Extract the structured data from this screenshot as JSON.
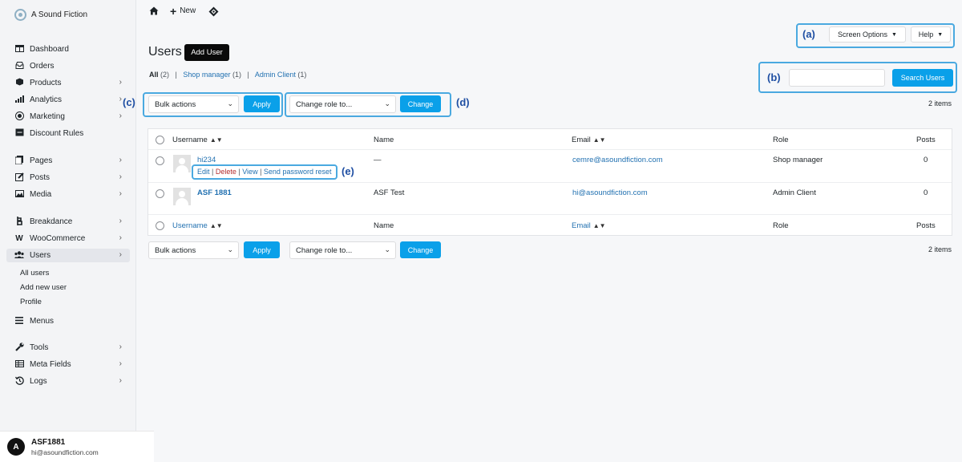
{
  "brand": {
    "name": "A Sound Fiction"
  },
  "topbar": {
    "new_label": "New"
  },
  "sidebar": {
    "items": [
      {
        "label": "Dashboard",
        "icon": "dashboard-icon"
      },
      {
        "label": "Orders",
        "icon": "orders-icon"
      },
      {
        "label": "Products",
        "icon": "products-icon"
      },
      {
        "label": "Analytics",
        "icon": "analytics-icon"
      },
      {
        "label": "Marketing",
        "icon": "marketing-icon"
      },
      {
        "label": "Discount Rules",
        "icon": "discount-icon"
      },
      {
        "label": "Pages",
        "icon": "pages-icon"
      },
      {
        "label": "Posts",
        "icon": "posts-icon"
      },
      {
        "label": "Media",
        "icon": "media-icon"
      },
      {
        "label": "Breakdance",
        "icon": "breakdance-icon"
      },
      {
        "label": "WooCommerce",
        "icon": "woocommerce-icon"
      },
      {
        "label": "Users",
        "icon": "users-icon"
      },
      {
        "label": "Menus",
        "icon": "menus-icon"
      },
      {
        "label": "Tools",
        "icon": "tools-icon"
      },
      {
        "label": "Meta Fields",
        "icon": "meta-fields-icon"
      },
      {
        "label": "Logs",
        "icon": "logs-icon"
      }
    ],
    "users_sub": [
      "All users",
      "Add new user",
      "Profile"
    ]
  },
  "account": {
    "initial": "A",
    "name": "ASF1881",
    "email": "hi@asoundfiction.com"
  },
  "header": {
    "title": "Users",
    "add_user": "Add User",
    "screen_options": "Screen Options",
    "help": "Help"
  },
  "filters": {
    "all": "All",
    "all_count": "(2)",
    "shop_manager": "Shop manager",
    "shop_manager_count": "(1)",
    "admin_client": "Admin Client",
    "admin_client_count": "(1)"
  },
  "search": {
    "value": "",
    "button": "Search Users"
  },
  "tablenav": {
    "bulk_actions": "Bulk actions",
    "apply": "Apply",
    "change_role": "Change role to...",
    "change": "Change",
    "count": "2 items"
  },
  "table": {
    "columns": {
      "username": "Username",
      "name": "Name",
      "email": "Email",
      "role": "Role",
      "posts": "Posts"
    },
    "rows": [
      {
        "username": "hi234",
        "name": "—",
        "email": "cemre@asoundfiction.com",
        "role": "Shop manager",
        "posts": "0"
      },
      {
        "username": "ASF 1881",
        "name": "ASF Test",
        "email": "hi@asoundfiction.com",
        "role": "Admin Client",
        "posts": "0"
      }
    ],
    "row_actions": {
      "edit": "Edit",
      "delete": "Delete",
      "view": "View",
      "send_reset": "Send password reset"
    }
  },
  "callouts": {
    "a": "(a)",
    "b": "(b)",
    "c": "(c)",
    "d": "(d)",
    "e": "(e)"
  },
  "colors": {
    "accent": "#0aa0e9",
    "callout": "#4aa9e0",
    "callout_label": "#1f4fa3"
  }
}
